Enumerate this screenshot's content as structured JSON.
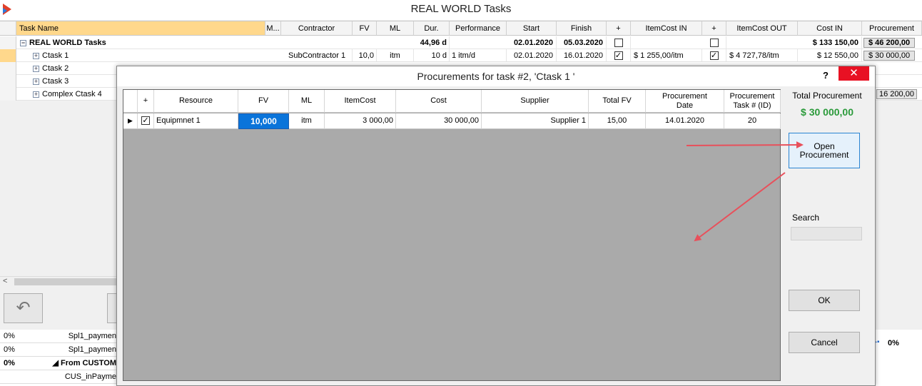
{
  "app": {
    "title": "REAL WORLD Tasks"
  },
  "grid": {
    "columns": [
      "Task Name",
      "M...",
      "Contractor",
      "FV",
      "ML",
      "Dur.",
      "Performance",
      "Start",
      "Finish",
      "+",
      "ItemCost IN",
      "+",
      "ItemCost OUT",
      "Cost IN",
      "Procurement"
    ],
    "root": {
      "name": "REAL WORLD Tasks",
      "dur": "44,96 d",
      "start": "02.01.2020",
      "finish": "05.03.2020",
      "cost_in": "$ 133 150,00",
      "procurement": "$ 46 200,00"
    },
    "row1": {
      "name": "Ctask 1",
      "contractor": "SubContractor 1",
      "fv": "10,0",
      "ml": "itm",
      "dur": "10 d",
      "performance": "1 itm/d",
      "start": "02.01.2020",
      "finish": "16.01.2020",
      "item_cost_in": "$ 1 255,00/itm",
      "item_cost_out": "$ 4 727,78/itm",
      "cost_in": "$ 12 550,00",
      "procurement": "$ 30 000,00"
    },
    "row2": {
      "name": "Ctask 2"
    },
    "row3": {
      "name": "Ctask 3"
    },
    "row4": {
      "name": "Complex Ctask 4",
      "procurement": "16 200,00"
    }
  },
  "bottom": {
    "rows": [
      {
        "pct": "0%",
        "text": "Spl1_paymen"
      },
      {
        "pct": "0%",
        "text": "Spl1_paymen"
      },
      {
        "pct": "0%",
        "text": "From CUSTOM"
      },
      {
        "pct": "",
        "text": "CUS_inPayme"
      }
    ],
    "right_pct": "0%"
  },
  "dialog": {
    "title": "Procurements for task #2, 'Ctask 1 '",
    "help": "?",
    "close": "✕",
    "columns": {
      "plus": "+",
      "resource": "Resource",
      "fv": "FV",
      "ml": "ML",
      "item_cost": "ItemCost",
      "cost": "Cost",
      "supplier": "Supplier",
      "total_fv": "Total FV",
      "proc_date": "Procurement Date",
      "proc_task": "Procurement Task # (ID)"
    },
    "row": {
      "checked": "✓",
      "resource": "Equipmnet 1",
      "fv": "10,000",
      "ml": "itm",
      "item_cost": "3 000,00",
      "cost": "30 000,00",
      "supplier": "Supplier 1",
      "total_fv": "15,00",
      "proc_date": "14.01.2020",
      "proc_task": "20"
    },
    "total_label": "Total Procurement",
    "total_value": "$ 30  000,00",
    "open_button": "Open Procurement",
    "search_label": "Search",
    "ok": "OK",
    "cancel": "Cancel"
  },
  "colors": {
    "selection": "#ffd88c",
    "accent": "#0a74da",
    "total": "#2a9a3a",
    "close": "#e81123",
    "arrow": "#e8505b"
  }
}
